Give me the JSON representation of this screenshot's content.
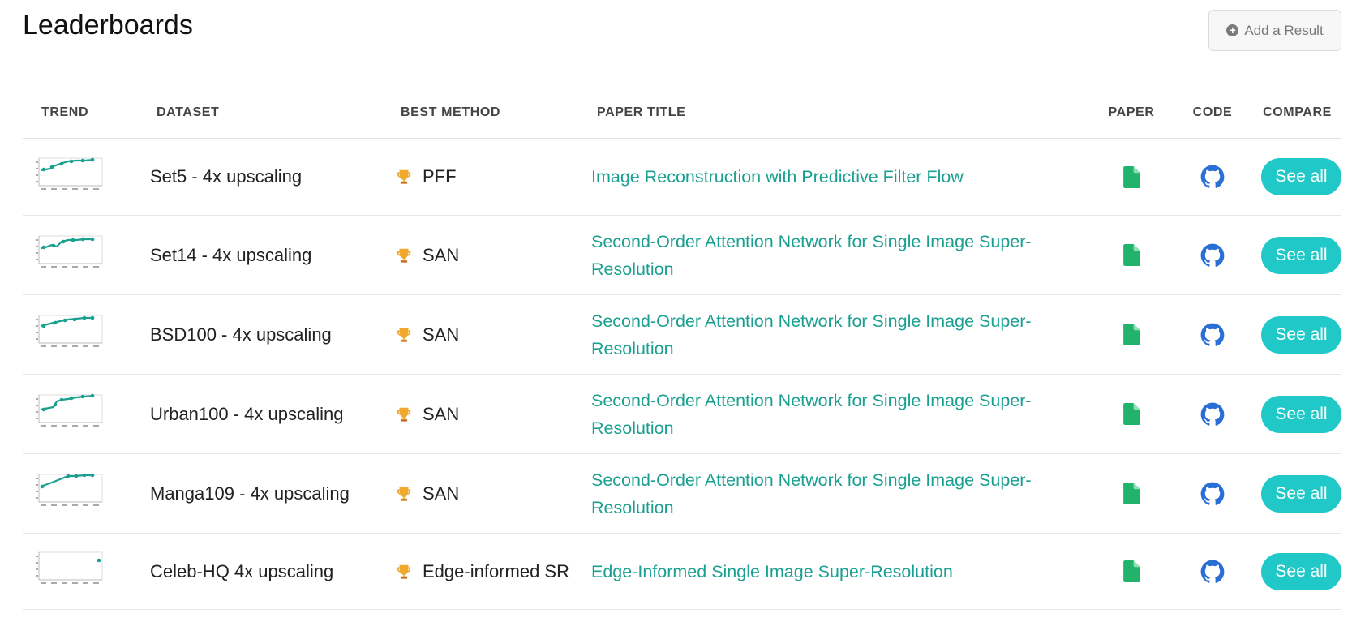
{
  "page": {
    "title": "Leaderboards",
    "add_button_label": "Add a Result",
    "add_button_icon": "plus-circle-icon"
  },
  "table": {
    "headers": {
      "trend": "TREND",
      "dataset": "DATASET",
      "best_method": "BEST METHOD",
      "paper_title": "PAPER TITLE",
      "paper": "PAPER",
      "code": "CODE",
      "compare": "COMPARE"
    },
    "rows": [
      {
        "dataset": "Set5 - 4x upscaling",
        "best_method": "PFF",
        "paper_title": "Image Reconstruction with Predictive Filter Flow",
        "compare_label": "See all"
      },
      {
        "dataset": "Set14 - 4x upscaling",
        "best_method": "SAN",
        "paper_title": "Second-Order Attention Network for Single Image Super-Resolution",
        "compare_label": "See all"
      },
      {
        "dataset": "BSD100 - 4x upscaling",
        "best_method": "SAN",
        "paper_title": "Second-Order Attention Network for Single Image Super-Resolution",
        "compare_label": "See all"
      },
      {
        "dataset": "Urban100 - 4x upscaling",
        "best_method": "SAN",
        "paper_title": "Second-Order Attention Network for Single Image Super-Resolution",
        "compare_label": "See all"
      },
      {
        "dataset": "Manga109 - 4x upscaling",
        "best_method": "SAN",
        "paper_title": "Second-Order Attention Network for Single Image Super-Resolution",
        "compare_label": "See all"
      },
      {
        "dataset": "Celeb-HQ 4x upscaling",
        "best_method": "Edge-informed SR",
        "paper_title": "Edge-Informed Single Image Super-Resolution",
        "compare_label": "See all"
      }
    ]
  },
  "icons": {
    "best_method": "trophy-icon",
    "paper": "paper-file-icon",
    "code": "github-icon"
  },
  "colors": {
    "accent_teal": "#21c8c8",
    "link": "#1aa091",
    "paper_icon": "#21b36b",
    "github_icon": "#2a6fd6",
    "trophy": "#f0a92c"
  }
}
